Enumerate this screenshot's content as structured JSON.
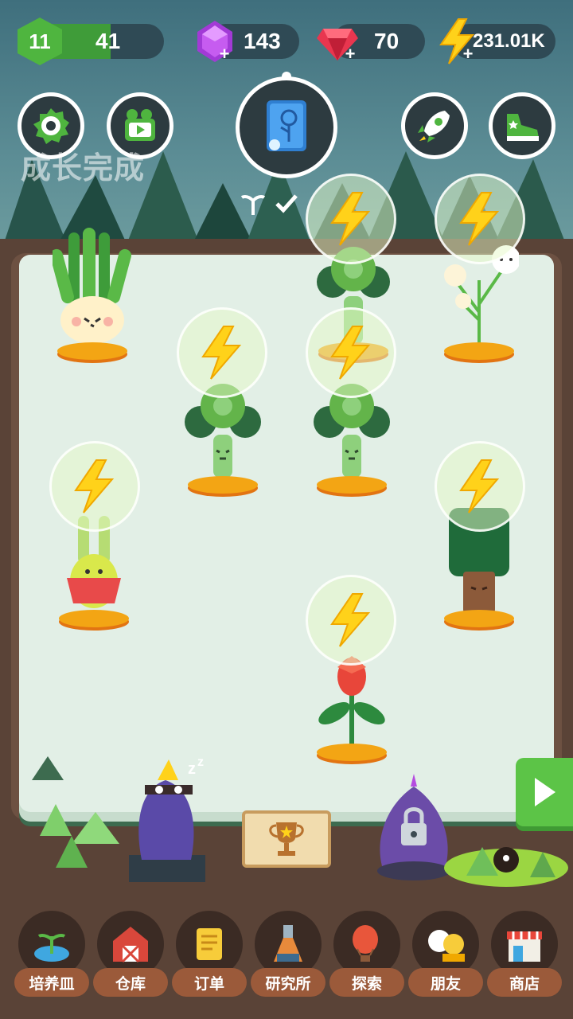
{
  "header": {
    "level": "11",
    "level_progress_value": "41",
    "level_progress_fraction": 0.6,
    "gems": "143",
    "rubies": "70",
    "energy": "231.01K"
  },
  "status": {
    "text": "成长完成"
  },
  "top_buttons": [
    {
      "name": "settings",
      "icon": "gear-icon"
    },
    {
      "name": "video",
      "icon": "video-camera-icon"
    },
    {
      "name": "book",
      "icon": "plant-book-icon"
    },
    {
      "name": "rocket",
      "icon": "rocket-icon"
    },
    {
      "name": "shoe",
      "icon": "sneaker-icon"
    }
  ],
  "plants": [
    {
      "kind": "onion",
      "bubble": false
    },
    {
      "kind": "broccoli",
      "bubble": true
    },
    {
      "kind": "dandelion",
      "bubble": true
    },
    {
      "kind": "broccoli",
      "bubble": true
    },
    {
      "kind": "broccoli",
      "bubble": true
    },
    {
      "kind": "radish",
      "bubble": true
    },
    {
      "kind": "tree",
      "bubble": true
    },
    {
      "kind": "flower",
      "bubble": true
    }
  ],
  "nav": [
    {
      "label": "培养皿",
      "icon": "seedling-icon"
    },
    {
      "label": "仓库",
      "icon": "barn-icon"
    },
    {
      "label": "订单",
      "icon": "scroll-icon"
    },
    {
      "label": "研究所",
      "icon": "lab-icon"
    },
    {
      "label": "探索",
      "icon": "balloon-icon"
    },
    {
      "label": "朋友",
      "icon": "friends-icon"
    },
    {
      "label": "商店",
      "icon": "shop-icon"
    }
  ],
  "colors": {
    "accent_green": "#5cc447",
    "energy_yellow": "#ffd21a",
    "gem_purple": "#a23ad6",
    "ruby_red": "#e8364f"
  }
}
